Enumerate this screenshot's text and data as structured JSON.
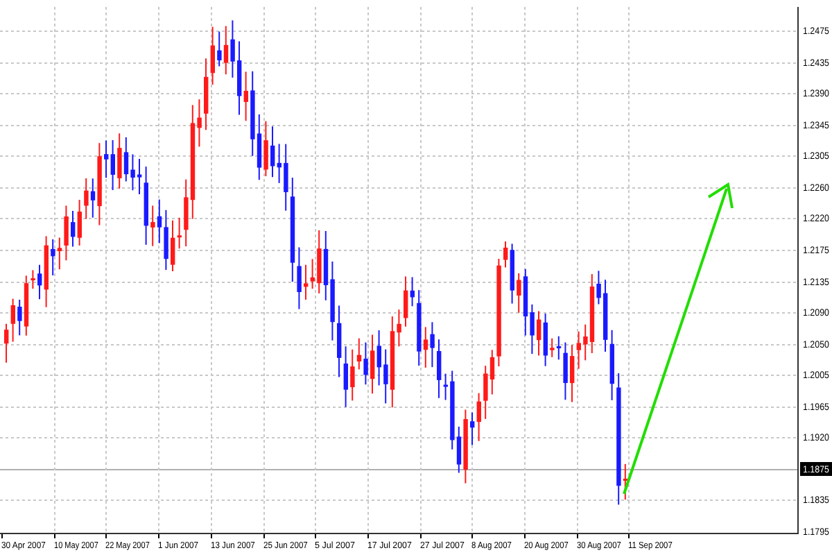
{
  "price_axis": {
    "ticks": [
      {
        "label": "1.2475",
        "current": false
      },
      {
        "label": "1.2435",
        "current": false
      },
      {
        "label": "1.2390",
        "current": false
      },
      {
        "label": "1.2345",
        "current": false
      },
      {
        "label": "1.2305",
        "current": false
      },
      {
        "label": "1.2260",
        "current": false
      },
      {
        "label": "1.2220",
        "current": false
      },
      {
        "label": "1.2175",
        "current": false
      },
      {
        "label": "1.2135",
        "current": false
      },
      {
        "label": "1.2090",
        "current": false
      },
      {
        "label": "1.2050",
        "current": false
      },
      {
        "label": "1.2005",
        "current": false
      },
      {
        "label": "1.1965",
        "current": false
      },
      {
        "label": "1.1920",
        "current": false
      },
      {
        "label": "1.1875",
        "current": true
      },
      {
        "label": "1.1835",
        "current": false
      },
      {
        "label": "1.1795",
        "current": false
      }
    ]
  },
  "time_axis": {
    "ticks": [
      "30 Apr 2007",
      "10 May 2007",
      "22 May 2007",
      "1 Jun 2007",
      "13 Jun 2007",
      "25 Jun 2007",
      "5 Jul 2007",
      "17 Jul 2007",
      "27 Jul 2007",
      "8 Aug 2007",
      "20 Aug 2007",
      "30 Aug 2007",
      "11 Sep 2007"
    ]
  }
}
